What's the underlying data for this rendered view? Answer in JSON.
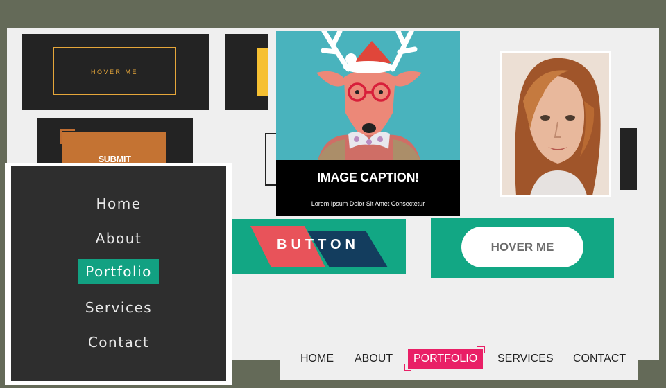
{
  "cards": {
    "hover_outline": {
      "label": "HOVER ME",
      "accent": "#e5a63a"
    },
    "submit": {
      "label": "SUBMIT",
      "color": "#c47333"
    },
    "caption": {
      "title": "IMAGE CAPTION!",
      "subtitle": "Lorem Ipsum Dolor Sit Amet Consectetur",
      "image_bg": "#49b3bd"
    },
    "skew_button": {
      "label": "BUTTON",
      "colors": [
        "#e8535a",
        "#133d5e"
      ],
      "bg": "#12a784"
    },
    "pill": {
      "label": "HOVER ME",
      "bg": "#12a784"
    }
  },
  "side_menu": {
    "items": [
      {
        "label": "Home"
      },
      {
        "label": "About"
      },
      {
        "label": "Portfolio",
        "active": true
      },
      {
        "label": "Services"
      },
      {
        "label": "Contact"
      }
    ],
    "accent": "#12a182"
  },
  "top_nav": {
    "items": [
      {
        "label": "HOME"
      },
      {
        "label": "ABOUT"
      },
      {
        "label": "PORTFOLIO",
        "active": true
      },
      {
        "label": "SERVICES"
      },
      {
        "label": "CONTACT"
      }
    ],
    "accent": "#e91f66"
  },
  "icons": {
    "deer": "deer-illustration-icon",
    "portrait": "portrait-image"
  }
}
